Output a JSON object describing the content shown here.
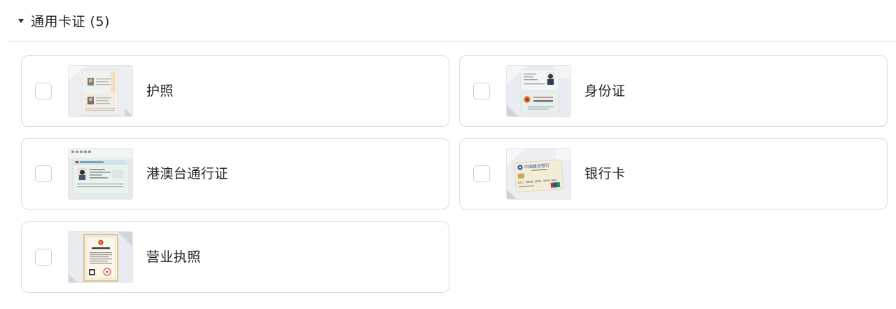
{
  "section": {
    "title": "通用卡证 (5)",
    "caret_icon": "caret-down-icon"
  },
  "cards": [
    {
      "label": "护照",
      "thumbnail": "passport-thumbnail"
    },
    {
      "label": "身份证",
      "thumbnail": "id-card-thumbnail"
    },
    {
      "label": "港澳台通行证",
      "thumbnail": "hk-macau-taiwan-permit-thumbnail"
    },
    {
      "label": "银行卡",
      "thumbnail": "bank-card-thumbnail"
    },
    {
      "label": "营业执照",
      "thumbnail": "business-license-thumbnail"
    }
  ],
  "bank_card_thumbnail_text": {
    "bank_name": "中国建设银行",
    "card_number": "6217 0000 1900 3699 400",
    "network": "UnionPay"
  },
  "colors": {
    "border": "#dcdcdc",
    "divider": "#e6e6e6",
    "text": "#222222"
  }
}
